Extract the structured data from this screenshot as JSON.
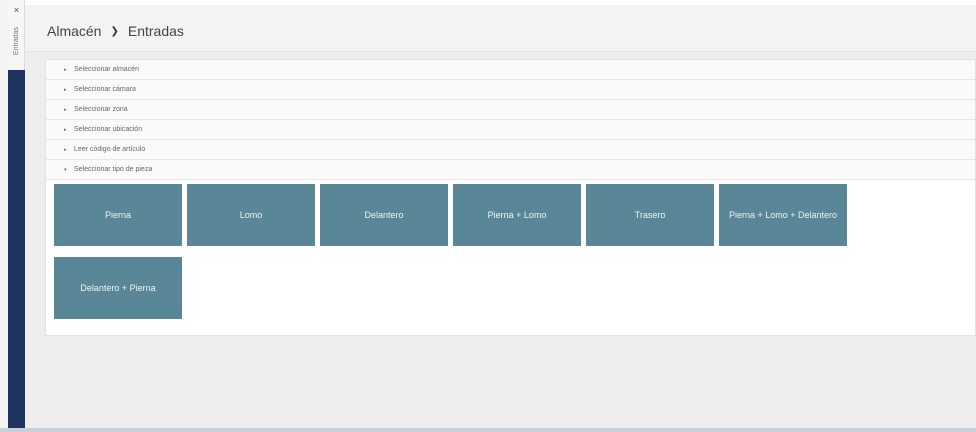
{
  "sidebar_tab": {
    "close_glyph": "×",
    "label": "Entradas"
  },
  "breadcrumb": {
    "items": [
      "Almacén",
      "Entradas"
    ],
    "separator": "❯"
  },
  "accordion": [
    {
      "label": "Seleccionar almacén",
      "caret": "▸"
    },
    {
      "label": "Seleccionar cámara",
      "caret": "▸"
    },
    {
      "label": "Seleccionar zona",
      "caret": "▸"
    },
    {
      "label": "Seleccionar ubicación",
      "caret": "▸"
    },
    {
      "label": "Leer código de artículo",
      "caret": "▸"
    },
    {
      "label": "Seleccionar tipo de pieza",
      "caret": "▾"
    }
  ],
  "piece_types": [
    "Pierna",
    "Lomo",
    "Delantero",
    "Pierna + Lomo",
    "Trasero",
    "Pierna + Lomo + Delantero",
    "Delantero + Pierna"
  ],
  "colors": {
    "sidebar": "#1f3560",
    "tile": "#5a8797"
  }
}
